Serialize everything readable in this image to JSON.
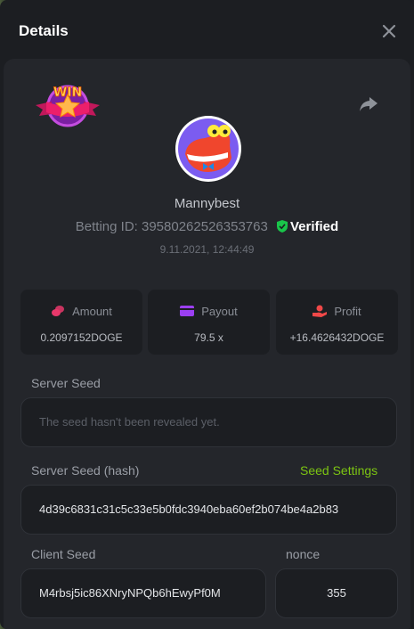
{
  "header": {
    "title": "Details"
  },
  "badge": {
    "text": "WIN"
  },
  "user": {
    "name": "Mannybest",
    "betting_id_label": "Betting ID:",
    "betting_id": "39580262526353763",
    "verified_label": "Verified",
    "datetime": "9.11.2021, 12:44:49"
  },
  "stats": [
    {
      "label": "Amount",
      "value": "0.2097152DOGE",
      "icon": "coins-icon",
      "color": "#e8386b"
    },
    {
      "label": "Payout",
      "value": "79.5 x",
      "icon": "wallet-icon",
      "color": "#9b3ff2"
    },
    {
      "label": "Profit",
      "value": "+16.4626432DOGE",
      "icon": "hand-coin-icon",
      "color": "#f04848"
    }
  ],
  "server_seed": {
    "label": "Server Seed",
    "placeholder": "The seed hasn't been revealed yet."
  },
  "server_seed_hash": {
    "label": "Server Seed (hash)",
    "settings_link": "Seed Settings",
    "value": "4d39c6831c31c5c33e5b0fdc3940eba60ef2b074be4a2b83"
  },
  "client_seed": {
    "label": "Client Seed",
    "value": "M4rbsj5ic86XNryNPQb6hEwyPf0M"
  },
  "nonce": {
    "label": "nonce",
    "value": "355"
  },
  "colors": {
    "accent_green": "#7cc412",
    "verified_shield": "#19c54a",
    "card_bg": "#24262b"
  }
}
